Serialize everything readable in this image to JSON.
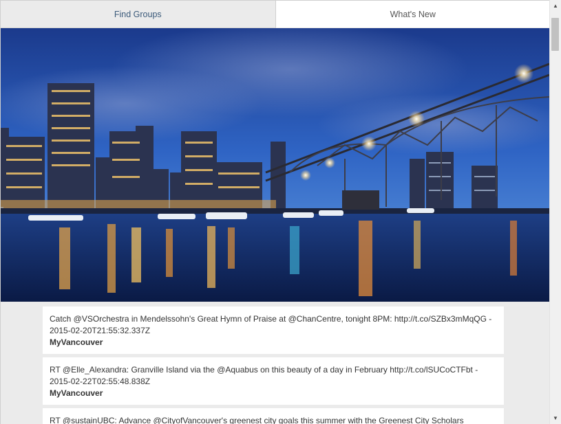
{
  "tabs": [
    {
      "label": "Find Groups"
    },
    {
      "label": "What's New"
    }
  ],
  "feed": [
    {
      "text": "Catch @VSOrchestra in Mendelssohn's Great Hymn of Praise at @ChanCentre, tonight 8PM: http://t.co/SZBx3mMqQG - 2015-02-20T21:55:32.337Z",
      "author": "MyVancouver"
    },
    {
      "text": "RT @Elle_Alexandra: Granville Island via the @Aquabus on this beauty of a day in February http://t.co/lSUCoCTFbt - 2015-02-22T02:55:48.838Z",
      "author": "MyVancouver"
    },
    {
      "text": "RT @sustainUBC: Advance @CityofVancouver's greenest city goals this summer with the Greenest City Scholars"
    }
  ],
  "icons": {
    "scroll_up": "scroll-up-arrow-icon",
    "scroll_down": "scroll-down-arrow-icon"
  }
}
